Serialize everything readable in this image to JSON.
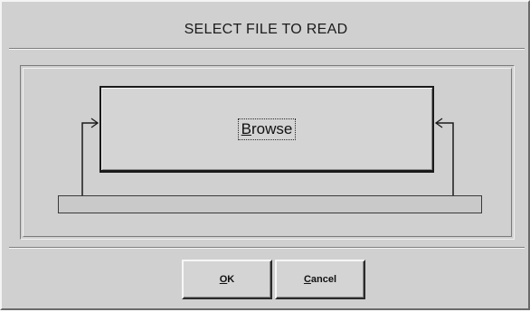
{
  "dialog": {
    "title": "SELECT FILE TO READ"
  },
  "browse": {
    "mnemonic": "B",
    "label_rest": "rowse"
  },
  "buttons": {
    "ok": {
      "mnemonic": "O",
      "label_rest": "K"
    },
    "cancel": {
      "mnemonic": "C",
      "label_rest": "ancel"
    }
  },
  "icons": {
    "left_arrow": "arrow-right-icon",
    "right_arrow": "arrow-left-icon"
  },
  "colors": {
    "background": "#d0d0d0",
    "text": "#111111"
  }
}
